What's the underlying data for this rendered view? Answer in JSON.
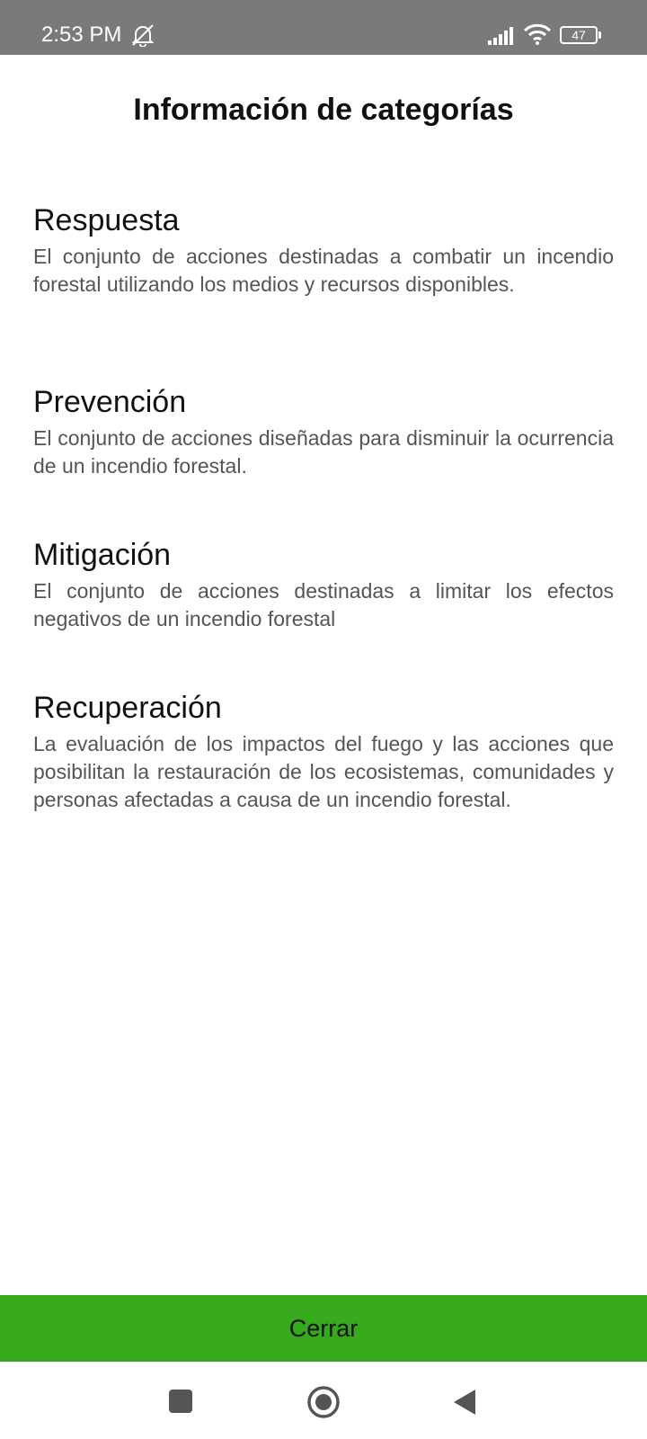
{
  "status_bar": {
    "time": "2:53 PM",
    "battery_level": "47",
    "icons": [
      "mute-icon",
      "signal-icon",
      "wifi-icon",
      "battery-icon"
    ]
  },
  "page": {
    "title": "Información de categorías"
  },
  "categories": [
    {
      "title": "Respuesta",
      "description": "El conjunto de acciones destinadas a combatir un incendio forestal utilizando los medios y recursos disponibles."
    },
    {
      "title": "Prevención",
      "description": "El conjunto de acciones diseñadas para disminuir la ocurrencia de un incendio forestal."
    },
    {
      "title": "Mitigación",
      "description": "El conjunto de acciones destinadas a limitar los efectos negativos de un incendio forestal"
    },
    {
      "title": "Recuperación",
      "description": "La evaluación de los impactos del fuego y las acciones que posibilitan la restauración de los ecosistemas, comunidades y personas afectadas a causa de un incendio forestal."
    }
  ],
  "actions": {
    "close_label": "Cerrar"
  },
  "colors": {
    "status_bar": "#7a7a7a",
    "accent_green": "#36a91d",
    "title_text": "#111111",
    "body_text": "#555555"
  },
  "nav_bar": {
    "icons": [
      "recent-apps-icon",
      "home-icon",
      "back-icon"
    ]
  }
}
